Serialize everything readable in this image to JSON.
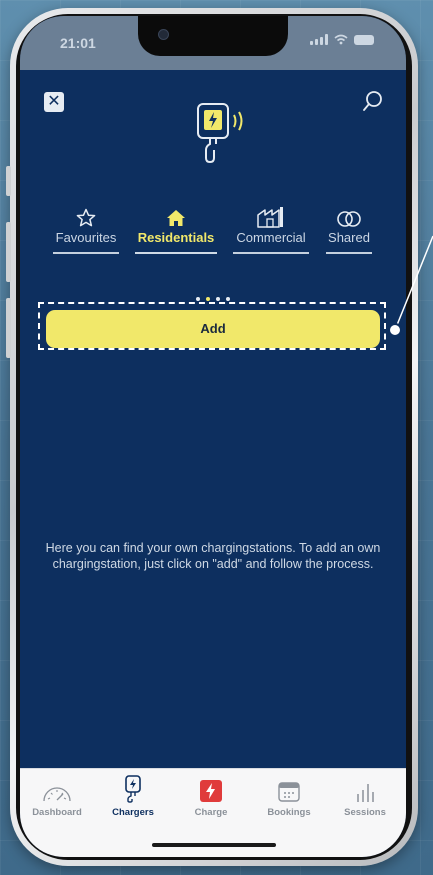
{
  "status_bar": {
    "time": "21:01"
  },
  "tabs": [
    {
      "label": "Favourites",
      "icon": "star-icon",
      "active": false
    },
    {
      "label": "Residentials",
      "icon": "home-icon",
      "active": true
    },
    {
      "label": "Commercial",
      "icon": "factory-icon",
      "active": false
    },
    {
      "label": "Shared",
      "icon": "shared-rings-icon",
      "active": false
    }
  ],
  "pager": {
    "count": 4,
    "active_index": 1
  },
  "add_button": {
    "label": "Add"
  },
  "info_text": "Here you can find your own chargingstations. To add an own chargingstation, just click on \"add\" and follow the process.",
  "bottom_nav": [
    {
      "label": "Dashboard",
      "icon": "speedometer-icon"
    },
    {
      "label": "Chargers",
      "icon": "charger-icon",
      "active": true
    },
    {
      "label": "Charge",
      "icon": "charge-bolt-icon"
    },
    {
      "label": "Bookings",
      "icon": "calendar-icon"
    },
    {
      "label": "Sessions",
      "icon": "bar-chart-icon"
    }
  ],
  "colors": {
    "app_background": "#0d2f5f",
    "accent_yellow": "#f1e86a",
    "charge_red": "#e03b3b",
    "nav_background": "#f7f7f8"
  }
}
